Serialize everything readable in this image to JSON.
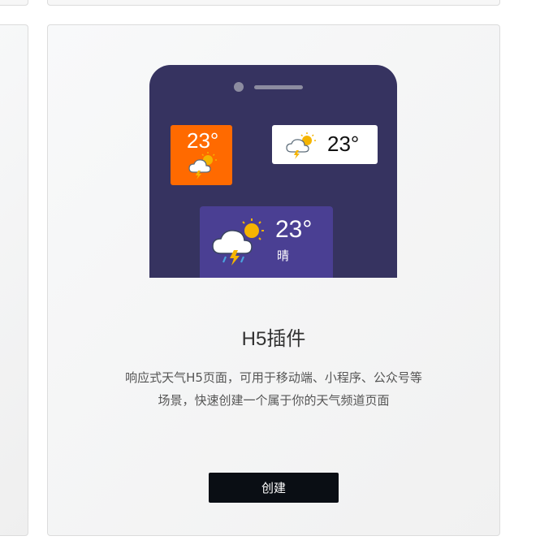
{
  "card": {
    "title": "H5插件",
    "description_line1": "响应式天气H5页面，可用于移动端、小程序、公众号等",
    "description_line2": "场景，快速创建一个属于你的天气频道页面",
    "create_label": "创建"
  },
  "widgets": {
    "orange": {
      "temp": "23°",
      "icon": "sun-cloud-thunder-icon"
    },
    "white": {
      "temp": "23°",
      "icon": "sun-cloud-thunder-icon"
    },
    "purple": {
      "temp": "23°",
      "condition": "晴",
      "icon": "sun-cloud-thunder-icon"
    }
  },
  "colors": {
    "phone": "#363360",
    "orange_widget": "#ff6a00",
    "purple_widget": "#4a3f93",
    "button": "#0a0e14"
  }
}
